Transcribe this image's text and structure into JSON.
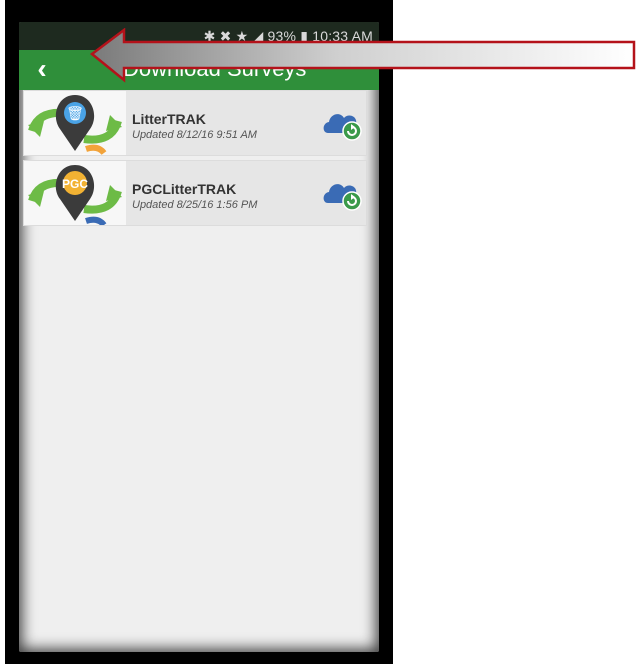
{
  "status_bar": {
    "text": "✱ ✖ ★ ◢ 93% ▮ 10:33 AM"
  },
  "app_bar": {
    "back_icon": "‹",
    "title": "Download Surveys"
  },
  "surveys": [
    {
      "name": "LitterTRAK",
      "updated": "Updated 8/12/16 9:51 AM",
      "badge": "🗑"
    },
    {
      "name": "PGCLitterTRAK",
      "updated": "Updated 8/25/16 1:56 PM",
      "badge": "PGC"
    }
  ],
  "colors": {
    "app_bar": "#2f8f3a",
    "cloud": "#3a6bb5",
    "refresh_badge": "#3a9a4a",
    "arrow_outline": "#b4121a"
  }
}
